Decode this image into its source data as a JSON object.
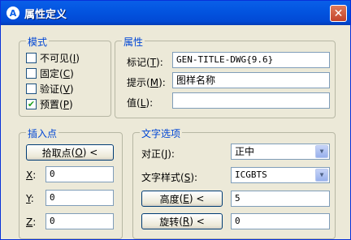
{
  "window": {
    "title": "属性定义",
    "close_glyph": "✕"
  },
  "mode": {
    "title": "模式",
    "items": [
      {
        "label": "不可见",
        "key": "I",
        "checked": false
      },
      {
        "label": "固定",
        "key": "C",
        "checked": false
      },
      {
        "label": "验证",
        "key": "V",
        "checked": false
      },
      {
        "label": "预置",
        "key": "P",
        "checked": true
      }
    ]
  },
  "attribute": {
    "title": "属性",
    "tag_label": "标记",
    "tag_key": "T",
    "tag_value": "GEN-TITLE-DWG{9.6}",
    "prompt_label": "提示",
    "prompt_key": "M",
    "prompt_value": "图样名称",
    "value_label": "值",
    "value_key": "L",
    "value_value": ""
  },
  "insert_point": {
    "title": "插入点",
    "pick_button": "拾取点",
    "pick_key": "O",
    "x_label": "X",
    "x_value": "0",
    "y_label": "Y",
    "y_value": "0",
    "z_label": "Z",
    "z_value": "0"
  },
  "text_options": {
    "title": "文字选项",
    "justify_label": "对正",
    "justify_key": "J",
    "justify_value": "正中",
    "style_label": "文字样式",
    "style_key": "S",
    "style_value": "ICGBTS",
    "height_button": "高度",
    "height_key": "E",
    "height_value": "5",
    "rotation_button": "旋转",
    "rotation_key": "R",
    "rotation_value": "0"
  },
  "icons": {
    "app": "autocad-icon",
    "check": "checkmark-icon",
    "arrow": "chevron-down-icon"
  }
}
